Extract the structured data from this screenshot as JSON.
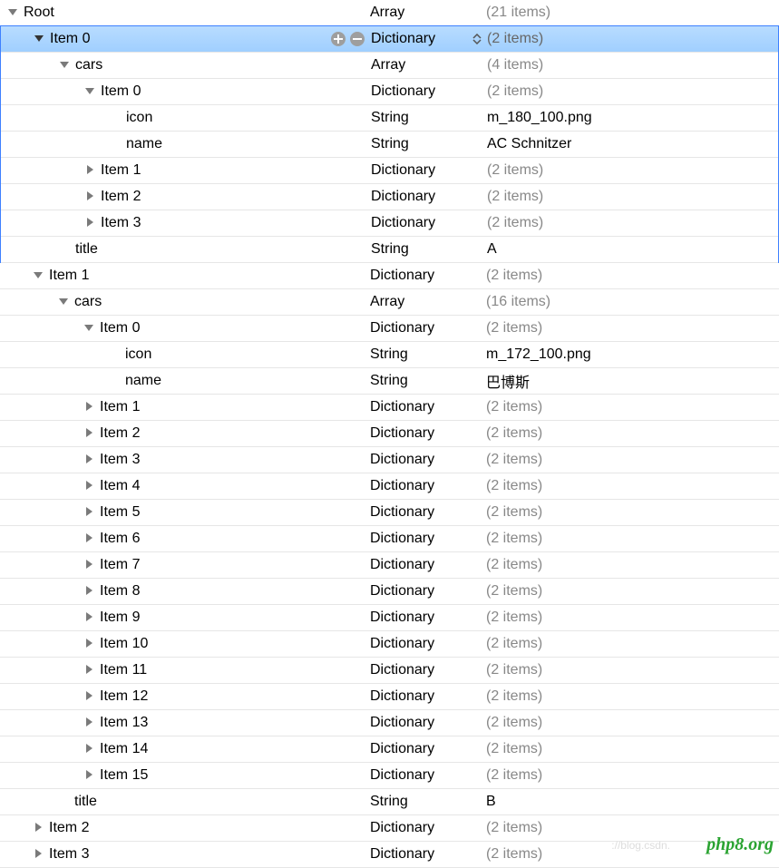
{
  "labels": {
    "root": "Root",
    "cars": "cars",
    "icon": "icon",
    "name": "name",
    "title": "title"
  },
  "types": {
    "array": "Array",
    "dict": "Dictionary",
    "string": "String"
  },
  "counts": {
    "root": "(21 items)",
    "two": "(2 items)",
    "four": "(4 items)",
    "sixteen": "(16 items)"
  },
  "items": {
    "i0": "Item 0",
    "i1": "Item 1",
    "i2": "Item 2",
    "i3": "Item 3",
    "i4": "Item 4",
    "i5": "Item 5",
    "i6": "Item 6",
    "i7": "Item 7",
    "i8": "Item 8",
    "i9": "Item 9",
    "i10": "Item 10",
    "i11": "Item 11",
    "i12": "Item 12",
    "i13": "Item 13",
    "i14": "Item 14",
    "i15": "Item 15"
  },
  "values": {
    "icon0": "m_180_100.png",
    "name0": "AC Schnitzer",
    "title_a": "A",
    "icon1": "m_172_100.png",
    "name1": "巴博斯",
    "title_b": "B"
  },
  "watermark": "php8.org",
  "watermark_faint": "://blog.csdn."
}
